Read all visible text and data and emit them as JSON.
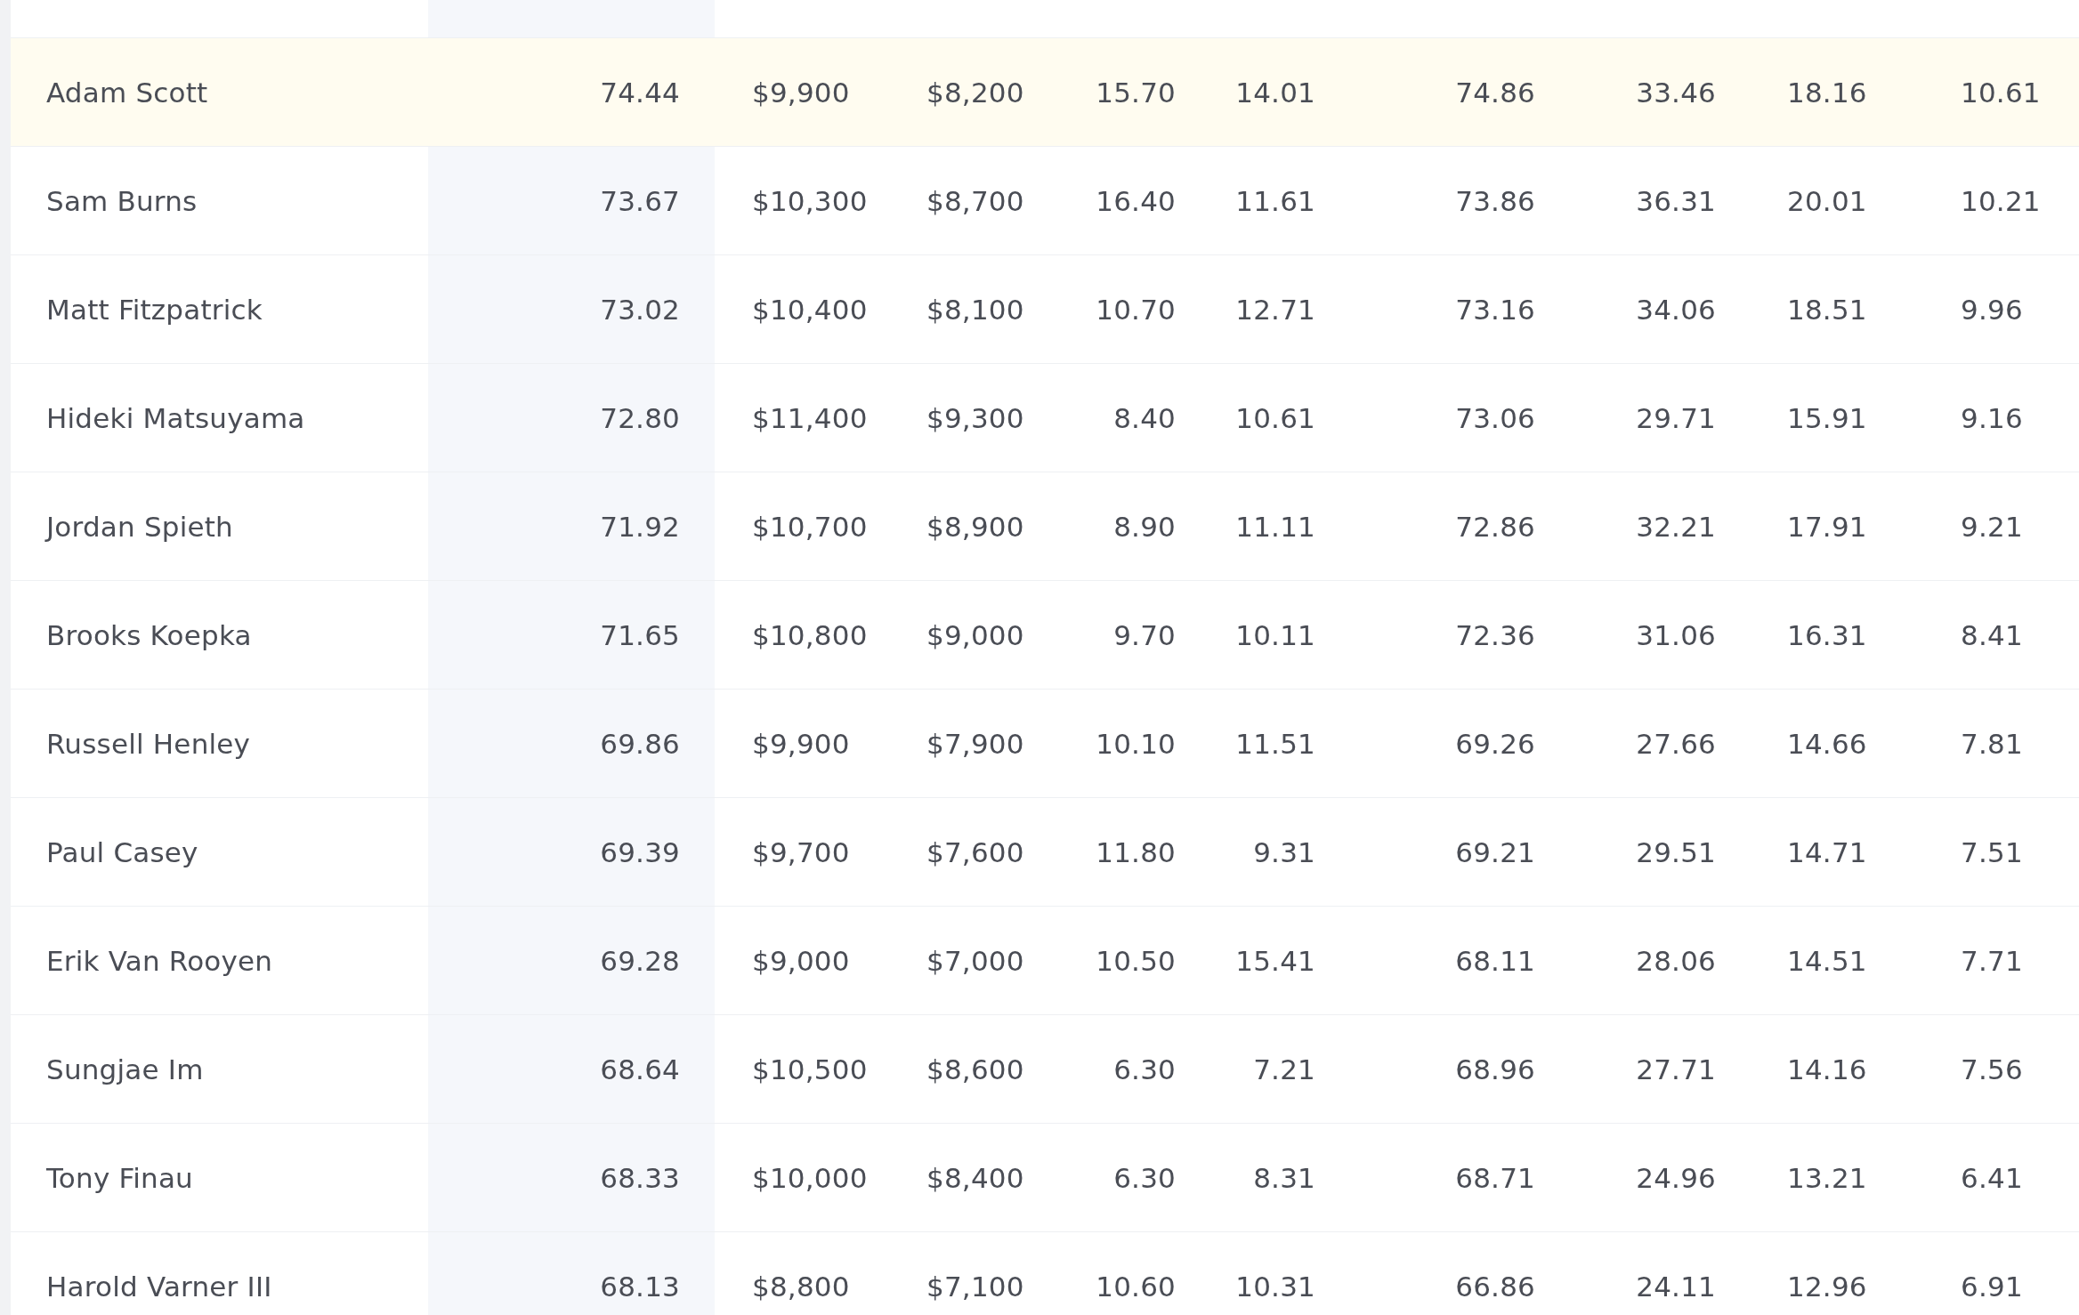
{
  "table": {
    "rows": [
      {
        "selected": true,
        "cells": [
          "Adam Scott",
          "74.44",
          "$9,900",
          "$8,200",
          "15.70",
          "14.01",
          "74.86",
          "33.46",
          "18.16",
          "10.61"
        ]
      },
      {
        "selected": false,
        "cells": [
          "Sam Burns",
          "73.67",
          "$10,300",
          "$8,700",
          "16.40",
          "11.61",
          "73.86",
          "36.31",
          "20.01",
          "10.21"
        ]
      },
      {
        "selected": false,
        "cells": [
          "Matt Fitzpatrick",
          "73.02",
          "$10,400",
          "$8,100",
          "10.70",
          "12.71",
          "73.16",
          "34.06",
          "18.51",
          "9.96"
        ]
      },
      {
        "selected": false,
        "cells": [
          "Hideki Matsuyama",
          "72.80",
          "$11,400",
          "$9,300",
          "8.40",
          "10.61",
          "73.06",
          "29.71",
          "15.91",
          "9.16"
        ]
      },
      {
        "selected": false,
        "cells": [
          "Jordan Spieth",
          "71.92",
          "$10,700",
          "$8,900",
          "8.90",
          "11.11",
          "72.86",
          "32.21",
          "17.91",
          "9.21"
        ]
      },
      {
        "selected": false,
        "cells": [
          "Brooks Koepka",
          "71.65",
          "$10,800",
          "$9,000",
          "9.70",
          "10.11",
          "72.36",
          "31.06",
          "16.31",
          "8.41"
        ]
      },
      {
        "selected": false,
        "cells": [
          "Russell Henley",
          "69.86",
          "$9,900",
          "$7,900",
          "10.10",
          "11.51",
          "69.26",
          "27.66",
          "14.66",
          "7.81"
        ]
      },
      {
        "selected": false,
        "cells": [
          "Paul Casey",
          "69.39",
          "$9,700",
          "$7,600",
          "11.80",
          "9.31",
          "69.21",
          "29.51",
          "14.71",
          "7.51"
        ]
      },
      {
        "selected": false,
        "cells": [
          "Erik Van Rooyen",
          "69.28",
          "$9,000",
          "$7,000",
          "10.50",
          "15.41",
          "68.11",
          "28.06",
          "14.51",
          "7.71"
        ]
      },
      {
        "selected": false,
        "cells": [
          "Sungjae Im",
          "68.64",
          "$10,500",
          "$8,600",
          "6.30",
          "7.21",
          "68.96",
          "27.71",
          "14.16",
          "7.56"
        ]
      },
      {
        "selected": false,
        "cells": [
          "Tony Finau",
          "68.33",
          "$10,000",
          "$8,400",
          "6.30",
          "8.31",
          "68.71",
          "24.96",
          "13.21",
          "6.41"
        ]
      },
      {
        "selected": false,
        "cells": [
          "Harold Varner III",
          "68.13",
          "$8,800",
          "$7,100",
          "10.60",
          "10.31",
          "66.86",
          "24.11",
          "12.96",
          "6.91"
        ]
      }
    ]
  }
}
